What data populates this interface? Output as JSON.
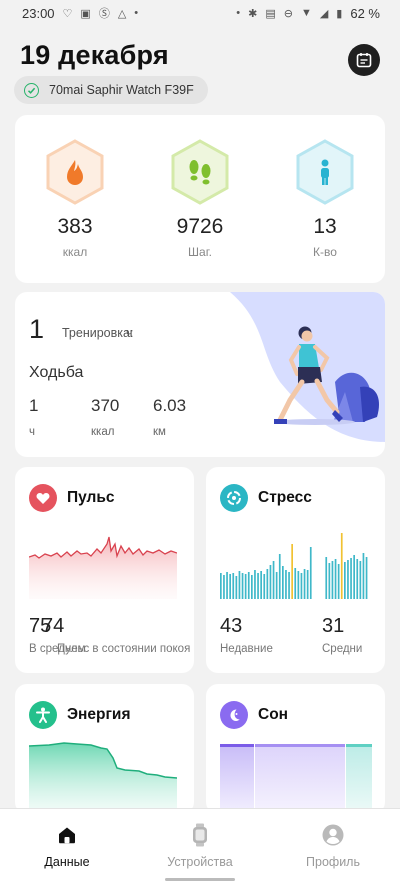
{
  "status_bar": {
    "time": "23:00",
    "battery": "62 %"
  },
  "header": {
    "date": "19 декабря",
    "device": "70mai Saphir Watch F39F"
  },
  "summary": [
    {
      "value": "383",
      "unit": "ккал",
      "icon": "flame-icon",
      "color": "#f07a2a"
    },
    {
      "value": "9726",
      "unit": "Шаг.",
      "icon": "footsteps-icon",
      "color": "#7fbf2e"
    },
    {
      "value": "13",
      "unit": "К-во",
      "icon": "person-standing-icon",
      "color": "#29b3d1"
    }
  ],
  "workout": {
    "count": "1",
    "label": "Тренировка:",
    "unit": "ч",
    "type": "Ходьба",
    "stats": [
      {
        "value": "1",
        "unit": "ч"
      },
      {
        "value": "370",
        "unit": "ккал"
      },
      {
        "value": "6.03",
        "unit": "км"
      }
    ]
  },
  "pulse": {
    "title": "Пульс",
    "value_1": "75",
    "value_2": "74",
    "label_1": "В среднем",
    "label_2": "Пульс в состоянии покоя",
    "color": "#e5535e"
  },
  "stress": {
    "title": "Стресс",
    "value_1": "43",
    "value_2": "31",
    "label_1": "Недавние",
    "label_2": "Средни",
    "color": "#2bb6c4"
  },
  "energy": {
    "title": "Энергия",
    "color": "#24c08c"
  },
  "sleep": {
    "title": "Сон",
    "color": "#8a6bf0"
  },
  "nav": {
    "data": "Данные",
    "devices": "Устройства",
    "profile": "Профиль"
  }
}
